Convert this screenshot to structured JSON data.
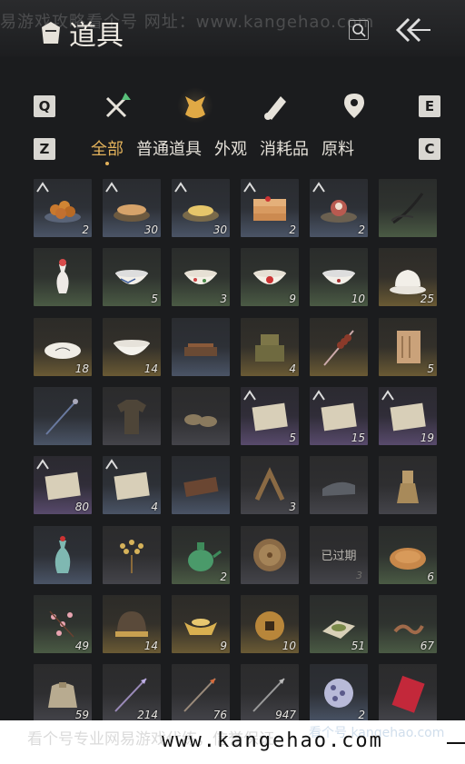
{
  "header": {
    "watermark_top": "易游戏攻略看个号   网址：www.kangehao.com",
    "title": "道具"
  },
  "keys": {
    "left_top": "Q",
    "right_top": "E",
    "left_sub": "Z",
    "right_sub": "C"
  },
  "categories": [
    {
      "icon": "weapon-icon"
    },
    {
      "icon": "bag-icon"
    },
    {
      "icon": "scroll-icon"
    },
    {
      "icon": "map-pin-icon"
    }
  ],
  "subtabs": [
    "全部",
    "普通道具",
    "外观",
    "消耗品",
    "原料"
  ],
  "items": [
    {
      "name": "fried-dumplings",
      "qty": "2",
      "rarity": "blue",
      "badge": true
    },
    {
      "name": "buns-plate",
      "qty": "30",
      "rarity": "blue",
      "badge": true
    },
    {
      "name": "noodle-plate",
      "qty": "30",
      "rarity": "blue",
      "badge": true
    },
    {
      "name": "cake-stack",
      "qty": "2",
      "rarity": "blue",
      "badge": true
    },
    {
      "name": "meat-dish",
      "qty": "2",
      "rarity": "blue",
      "badge": true
    },
    {
      "name": "whip",
      "qty": "",
      "rarity": "green",
      "badge": false
    },
    {
      "name": "vase-white",
      "qty": "",
      "rarity": "green",
      "badge": false
    },
    {
      "name": "bowl-blue-pattern",
      "qty": "5",
      "rarity": "green",
      "badge": false
    },
    {
      "name": "bowl-floral",
      "qty": "3",
      "rarity": "green",
      "badge": false
    },
    {
      "name": "bowl-rooster",
      "qty": "9",
      "rarity": "green",
      "badge": false
    },
    {
      "name": "bowl-plain",
      "qty": "10",
      "rarity": "green",
      "badge": false
    },
    {
      "name": "lidded-bowl",
      "qty": "25",
      "rarity": "gold",
      "badge": false
    },
    {
      "name": "plate-ink",
      "qty": "18",
      "rarity": "gold",
      "badge": false
    },
    {
      "name": "bowl-large",
      "qty": "14",
      "rarity": "gold",
      "badge": false
    },
    {
      "name": "chess-board",
      "qty": "",
      "rarity": "blue",
      "badge": false
    },
    {
      "name": "bronze-seal",
      "qty": "4",
      "rarity": "gold",
      "badge": false
    },
    {
      "name": "candied-skewer",
      "qty": "",
      "rarity": "gold",
      "badge": false
    },
    {
      "name": "wooden-tablet",
      "qty": "5",
      "rarity": "gold",
      "badge": false
    },
    {
      "name": "hairpin",
      "qty": "",
      "rarity": "blue",
      "badge": false
    },
    {
      "name": "cloth-armor",
      "qty": "",
      "rarity": "gray",
      "badge": false
    },
    {
      "name": "shoes",
      "qty": "",
      "rarity": "gray",
      "badge": false
    },
    {
      "name": "letter-1",
      "qty": "5",
      "rarity": "purple",
      "badge": true
    },
    {
      "name": "letter-2",
      "qty": "15",
      "rarity": "purple",
      "badge": true
    },
    {
      "name": "letter-3",
      "qty": "19",
      "rarity": "purple",
      "badge": true
    },
    {
      "name": "letter-4",
      "qty": "80",
      "rarity": "purple",
      "badge": true
    },
    {
      "name": "letter-5",
      "qty": "4",
      "rarity": "blue",
      "badge": true
    },
    {
      "name": "wooden-tray",
      "qty": "",
      "rarity": "blue",
      "badge": false
    },
    {
      "name": "carpenter-square",
      "qty": "3",
      "rarity": "gray",
      "badge": false
    },
    {
      "name": "stone-pillow",
      "qty": "",
      "rarity": "gray",
      "badge": false
    },
    {
      "name": "statue",
      "qty": "",
      "rarity": "gray",
      "badge": false
    },
    {
      "name": "celadon-vase",
      "qty": "",
      "rarity": "blue",
      "badge": false
    },
    {
      "name": "golden-branch",
      "qty": "",
      "rarity": "gray",
      "badge": false
    },
    {
      "name": "jade-pot",
      "qty": "2",
      "rarity": "green",
      "badge": false
    },
    {
      "name": "bronze-mirror",
      "qty": "",
      "rarity": "gray",
      "badge": false
    },
    {
      "name": "expired-item",
      "qty": "3",
      "rarity": "gray",
      "badge": false,
      "expired": "已过期"
    },
    {
      "name": "flatbread",
      "qty": "6",
      "rarity": "green",
      "badge": false
    },
    {
      "name": "plum-blossom",
      "qty": "49",
      "rarity": "green",
      "badge": false
    },
    {
      "name": "helmet",
      "qty": "14",
      "rarity": "gold",
      "badge": false
    },
    {
      "name": "gold-ingot",
      "qty": "9",
      "rarity": "gold",
      "badge": false
    },
    {
      "name": "copper-coin",
      "qty": "10",
      "rarity": "gold",
      "badge": false
    },
    {
      "name": "herb-powder",
      "qty": "51",
      "rarity": "green",
      "badge": false
    },
    {
      "name": "worm",
      "qty": "67",
      "rarity": "green",
      "badge": false
    },
    {
      "name": "cloth-sack",
      "qty": "59",
      "rarity": "gray",
      "badge": false
    },
    {
      "name": "arrow-purple",
      "qty": "214",
      "rarity": "gray",
      "badge": false
    },
    {
      "name": "arrow-fire",
      "qty": "76",
      "rarity": "gray",
      "badge": false
    },
    {
      "name": "arrow-plain",
      "qty": "947",
      "rarity": "gray",
      "badge": false
    },
    {
      "name": "ornament-ball",
      "qty": "2",
      "rarity": "blue",
      "badge": false
    },
    {
      "name": "red-envelope",
      "qty": "",
      "rarity": "gray",
      "badge": false
    }
  ],
  "footer": {
    "faded_text": "看个号专业网易游戏代练，信誉保证",
    "url": "www.kangehao.com",
    "logo_text": "看个号 kangehao.com"
  },
  "colors": {
    "accent": "#e3b25b",
    "active_icon": "#e0a945",
    "bg": "#1b1c1e"
  }
}
